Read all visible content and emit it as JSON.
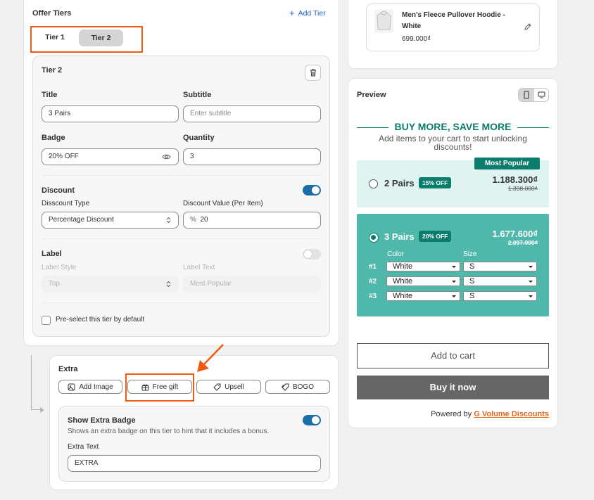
{
  "offer_tiers": {
    "title": "Offer Tiers",
    "add_tier": "Add Tier",
    "tabs": [
      "Tier 1",
      "Tier 2"
    ]
  },
  "tier": {
    "heading": "Tier 2",
    "title_label": "Title",
    "title_value": "3 Pairs",
    "subtitle_label": "Subtitle",
    "subtitle_placeholder": "Enter subtitle",
    "badge_label": "Badge",
    "badge_value": "20% OFF",
    "quantity_label": "Quantity",
    "quantity_value": "3",
    "discount_heading": "Discount",
    "discount_type_label": "Disscount Type",
    "discount_type_value": "Percentage Discount",
    "discount_value_label": "Discount Value (Per Item)",
    "discount_value_prefix": "%",
    "discount_value": "20",
    "label_heading": "Label",
    "label_style_label": "Label Style",
    "label_style_value": "Top",
    "label_text_label": "Label Text",
    "label_text_placeholder": "Most Popular",
    "preselect": "Pre-select this tier by default"
  },
  "extra": {
    "heading": "Extra",
    "buttons": [
      "Add Image",
      "Free gift",
      "Upsell",
      "BOGO"
    ],
    "show_badge_title": "Show Extra Badge",
    "show_badge_desc": "Shows an extra badge on this tier to hint that it includes a bonus.",
    "extra_text_label": "Extra Text",
    "extra_text_value": "EXTRA"
  },
  "product": {
    "name": "Men's Fleece Pullover Hoodie - White",
    "price": "699.000₫"
  },
  "preview": {
    "title": "Preview",
    "headline": "BUY MORE, SAVE MORE",
    "subline": "Add items to your cart to start unlocking discounts!",
    "most_popular": "Most Popular",
    "tier1": {
      "title": "2 Pairs",
      "badge": "15% OFF",
      "price": "1.188.300₫",
      "compare": "1.398.000₫"
    },
    "tier2": {
      "title": "3 Pairs",
      "badge": "20% OFF",
      "price": "1.677.600₫",
      "compare": "2.097.000₫"
    },
    "color_label": "Color",
    "size_label": "Size",
    "rows": [
      {
        "num": "#1",
        "color": "White",
        "size": "S"
      },
      {
        "num": "#2",
        "color": "White",
        "size": "S"
      },
      {
        "num": "#3",
        "color": "White",
        "size": "S"
      }
    ],
    "add_to_cart": "Add to cart",
    "buy_now": "Buy it now",
    "powered_by": "Powered by",
    "brand": "G Volume Discounts"
  },
  "colors": {
    "accent_teal": "#0b7d6c",
    "selected_tier_bg": "#4fb8ab",
    "light_tier_bg": "#dff3f1",
    "toggle_blue": "#1b6fa8",
    "highlight_orange": "#f15a13",
    "buy_now_bg": "#666666"
  }
}
